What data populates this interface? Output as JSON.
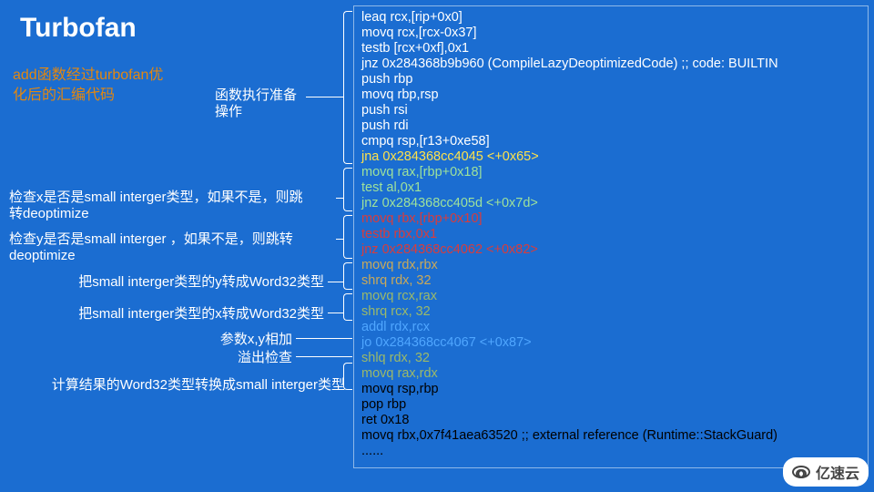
{
  "title": "Turbofan",
  "subtitle_l1": "add函数经过turbofan优",
  "subtitle_l2": "化后的汇编代码",
  "annot": {
    "prep_l1": "函数执行准备",
    "prep_l2": "操作",
    "check_x_l1": "检查x是否是small interger类型，如果不是，则跳",
    "check_x_l2": "转deoptimize",
    "check_y_l1": "检查y是否是small interger ，如果不是，则跳转",
    "check_y_l2": "deoptimize",
    "conv_y": "把small interger类型的y转成Word32类型",
    "conv_x": "把small interger类型的x转成Word32类型",
    "add": "参数x,y相加",
    "overflow": "溢出检查",
    "result": "计算结果的Word32类型转换成small interger类型"
  },
  "code": [
    {
      "cls": "c-white",
      "t": "leaq rcx,[rip+0x0]"
    },
    {
      "cls": "c-white",
      "t": "movq rcx,[rcx-0x37]"
    },
    {
      "cls": "c-white",
      "t": "testb [rcx+0xf],0x1"
    },
    {
      "cls": "c-white",
      "t": "jnz 0x284368b9b960  (CompileLazyDeoptimizedCode)    ;; code: BUILTIN"
    },
    {
      "cls": "c-white",
      "t": "push rbp"
    },
    {
      "cls": "c-white",
      "t": "movq rbp,rsp"
    },
    {
      "cls": "c-white",
      "t": "push rsi"
    },
    {
      "cls": "c-white",
      "t": "push rdi"
    },
    {
      "cls": "c-white",
      "t": "cmpq rsp,[r13+0xe58]"
    },
    {
      "cls": "c-yellow",
      "t": "jna 0x284368cc4045  <+0x65>"
    },
    {
      "cls": "c-green",
      "t": "movq rax,[rbp+0x18]"
    },
    {
      "cls": "c-green",
      "t": "test al,0x1"
    },
    {
      "cls": "c-green",
      "t": "jnz 0x284368cc405d  <+0x7d>"
    },
    {
      "cls": "c-red",
      "t": "movq rbx,[rbp+0x10]"
    },
    {
      "cls": "c-red",
      "t": "testb rbx,0x1"
    },
    {
      "cls": "c-red",
      "t": "jnz 0x284368cc4062  <+0x82>"
    },
    {
      "cls": "c-gold",
      "t": "movq rdx,rbx"
    },
    {
      "cls": "c-gold",
      "t": "shrq rdx, 32"
    },
    {
      "cls": "c-olive",
      "t": "movq rcx,rax"
    },
    {
      "cls": "c-olive",
      "t": "shrq rcx, 32"
    },
    {
      "cls": "c-blue",
      "t": "addl rdx,rcx"
    },
    {
      "cls": "c-blue",
      "t": "jo 0x284368cc4067  <+0x87>"
    },
    {
      "cls": "c-olive",
      "t": "shlq rdx, 32"
    },
    {
      "cls": "c-olive",
      "t": "movq rax,rdx"
    },
    {
      "cls": "c-dark",
      "t": "movq rsp,rbp"
    },
    {
      "cls": "c-dark",
      "t": "pop rbp"
    },
    {
      "cls": "c-dark",
      "t": "ret 0x18"
    },
    {
      "cls": "c-dark",
      "t": "movq rbx,0x7f41aea63520    ;; external reference (Runtime::StackGuard)"
    },
    {
      "cls": "c-dark",
      "t": "......"
    }
  ],
  "watermark": "亿速云"
}
